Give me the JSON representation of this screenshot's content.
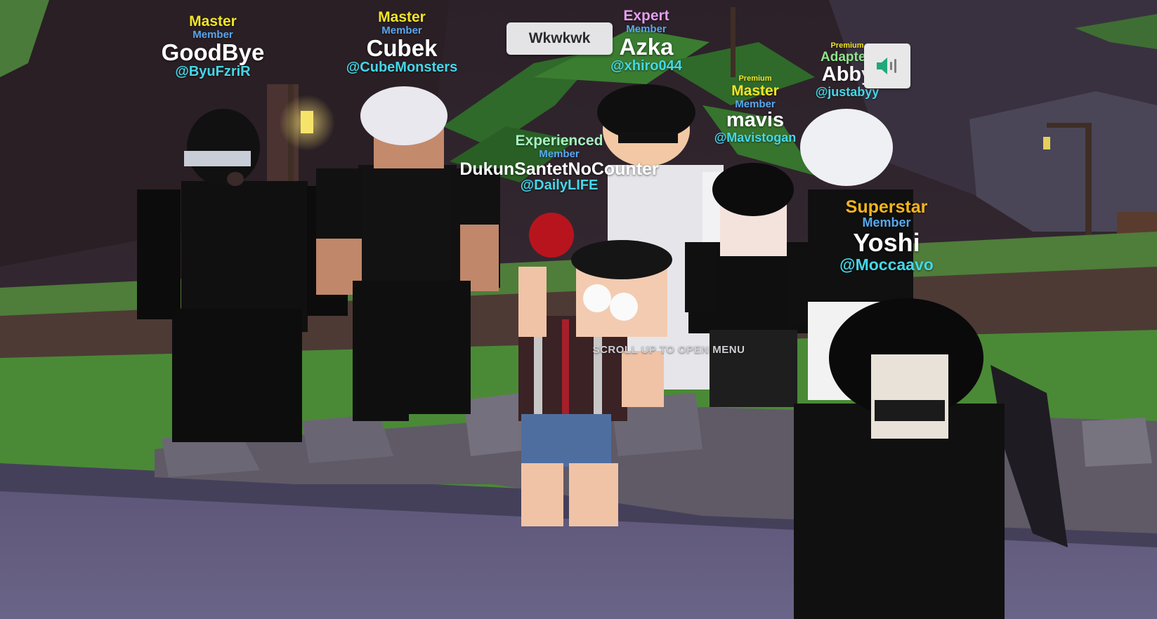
{
  "chat_bubble": {
    "text": "Wkwkwk"
  },
  "hint": {
    "text": "SCROLL UP TO OPEN MENU"
  },
  "voice_button": {
    "icon": "speaker-icon",
    "icon_color": "#1fa97a"
  },
  "colors": {
    "Master": "#f1e526",
    "Expert": "#e49ef0",
    "Experienced": "#a6f0c2",
    "Superstar": "#f4b51c",
    "Adapted": "#8ee58a",
    "Premium": "#f1e526",
    "Member": "#58a8f0",
    "handle": "#44d7e8"
  },
  "players": [
    {
      "rank": "Master",
      "member": "Member",
      "name": "GoodBye",
      "handle": "@ByuFzriR"
    },
    {
      "rank": "Master",
      "member": "Member",
      "name": "Cubek",
      "handle": "@CubeMonsters"
    },
    {
      "rank": "Expert",
      "member": "Member",
      "name": "Azka",
      "handle": "@xhiro044"
    },
    {
      "rank": "Experienced",
      "member": "Member",
      "name": "DukunSantetNoCounter",
      "handle": "@DailyLIFE"
    },
    {
      "premium": "Premium",
      "rank": "Master",
      "member": "Member",
      "name": "mavis",
      "handle": "@Mavistogan"
    },
    {
      "premium": "Premium",
      "rank": "Adapted",
      "name": "Abby",
      "handle": "@justabyy"
    },
    {
      "rank": "Superstar",
      "member": "Member",
      "name": "Yoshi",
      "handle": "@Moccaavo"
    }
  ]
}
